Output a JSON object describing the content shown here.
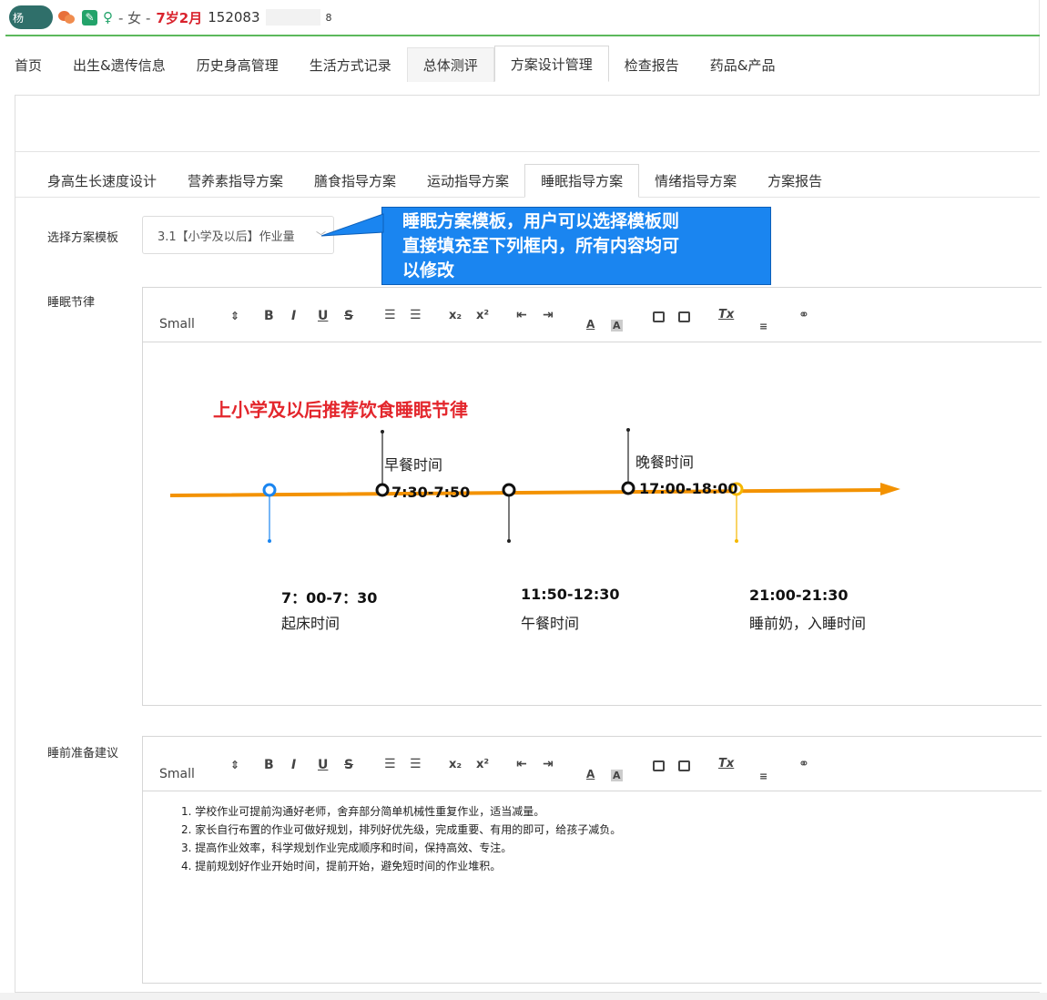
{
  "patient": {
    "name_visible": "杨",
    "gender_text": "- 女 -",
    "age": "7岁2月",
    "phone_visible": "152083",
    "trailing_digit": "8"
  },
  "main_tabs": [
    "首页",
    "出生&遗传信息",
    "历史身高管理",
    "生活方式记录",
    "总体测评",
    "方案设计管理",
    "检查报告",
    "药品&产品"
  ],
  "sub_tabs": [
    "身高生长速度设计",
    "营养素指导方案",
    "膳食指导方案",
    "运动指导方案",
    "睡眠指导方案",
    "情绪指导方案",
    "方案报告"
  ],
  "template_select": {
    "label": "选择方案模板",
    "value": "3.1【小学及以后】作业量"
  },
  "callout": {
    "line1": "睡眠方案模板，用户可以选择模板则",
    "line2": "直接填充至下列框内，所有内容均可",
    "line3": "以修改"
  },
  "toolbar": {
    "size": "Small",
    "size_arrow": "⇕",
    "bold": "B",
    "italic": "I",
    "underline": "U",
    "strike": "S",
    "subscript": "x₂",
    "superscript": "x²",
    "color": "A",
    "bg_color": "A",
    "clear": "Tx"
  },
  "sleep_rhythm": {
    "label": "睡眠节律",
    "chart_title": "上小学及以后推荐饮食睡眠节律",
    "events": [
      {
        "name": "起床时间",
        "time": "7：00-7：30"
      },
      {
        "name": "早餐时间",
        "time": "7:30-7:50"
      },
      {
        "name": "午餐时间",
        "time": "11:50-12:30"
      },
      {
        "name": "晚餐时间",
        "time": "17:00-18:00"
      },
      {
        "name": "睡前奶，入睡时间",
        "time": "21:00-21:30"
      }
    ]
  },
  "pre_sleep": {
    "label": "睡前准备建议",
    "items": [
      "1. 学校作业可提前沟通好老师，舍弃部分简单机械性重复作业，适当减量。",
      "2. 家长自行布置的作业可做好规划，排列好优先级，完成重要、有用的即可，给孩子减负。",
      "3. 提高作业效率，科学规划作业完成顺序和时间，保持高效、专注。",
      "4. 提前规划好作业开始时间，提前开始，避免短时间的作业堆积。"
    ]
  },
  "colors": {
    "accent_green": "#5cb85c",
    "age_red": "#d9232d",
    "callout_blue": "#1a85f0",
    "timeline_orange": "#f39200",
    "title_red": "#e3262c",
    "dot_blue": "#1a85f0",
    "dot_yellow": "#f5b800"
  }
}
